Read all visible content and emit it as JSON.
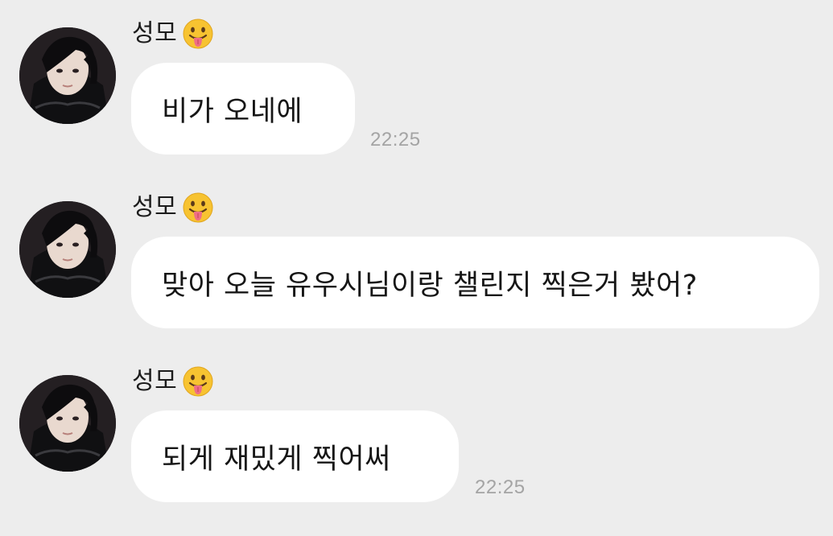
{
  "chat": {
    "messages": [
      {
        "sender": "성모",
        "text": "비가 오네에",
        "time": "22:25"
      },
      {
        "sender": "성모",
        "text": "맞아 오늘 유우시님이랑 챌린지 찍은거 봤어?",
        "time": ""
      },
      {
        "sender": "성모",
        "text": "되게 재밌게 찍어써",
        "time": "22:25"
      }
    ]
  },
  "icons": {
    "sender_emoji": "face-with-tongue-icon",
    "avatar": "profile-photo"
  },
  "colors": {
    "background": "#ededed",
    "bubble": "#ffffff",
    "timestamp": "#a4a4a4"
  }
}
